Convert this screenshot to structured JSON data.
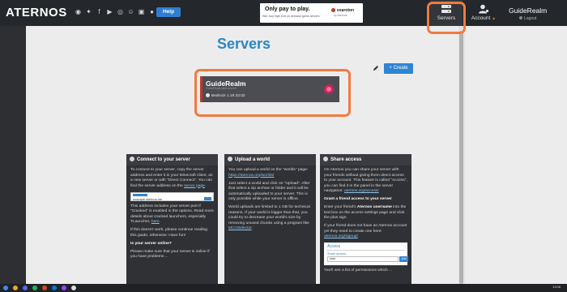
{
  "brand": {
    "logo": "ATERNOS",
    "help": "Help",
    "accent": "#2f85d2",
    "title_color": "#2c86c5"
  },
  "social_icons": [
    "steam-icon",
    "twitter-icon",
    "facebook-icon",
    "youtube-icon",
    "instagram-icon",
    "discord-icon",
    "twitch-icon",
    "github-icon"
  ],
  "ad": {
    "title": "Only pay to play.",
    "subtitle": "Win, buy high end on demand game servers",
    "brand": "exaroton",
    "brand_sub": "by Aternos"
  },
  "nav": {
    "servers_label": "Servers",
    "account_label": "Account",
    "account_warning": "▲",
    "user_name": "GuideRealm",
    "logout": "Logout"
  },
  "page": {
    "title": "Servers",
    "create_label": "+ Create"
  },
  "server": {
    "name": "GuideRealm",
    "address": "GuideRealm.aternos.me",
    "version": "Bedrock 1.19.33.02",
    "status_color": "#c9245e",
    "accent": "#c0392b"
  },
  "connect": {
    "title": "Connect to your server",
    "p1_a": "To connect to your server, copy the server address and enter it in your Minecraft client, as a new server or with \"Direct Connect\". You can find the server address on the ",
    "p1_link": "server page",
    "p1_b": ".",
    "address_example": "example.aternos.me",
    "p2_a": "This address includes your server port if \"Cracked\" is enabled in the options. Read more details about cracked launchers, especially TLauncher, ",
    "p2_link": "here",
    "p2_b": ".",
    "p3": "If this doesn't work, please continue reading this guide, otherwise: Have fun!",
    "q": "Is your server online?",
    "p4": "Please make sure that your server is online if you have problems ..."
  },
  "upload": {
    "title": "Upload a world",
    "p1_a": "You can upload a world on the \"worlds\" page: ",
    "p1_link": "https://aternos.org/worlds/",
    "p2": "Just select a world and click on \"Upload\". After that select a zip archive or folder and it will be automatically uploaded to your server. This is only possible while your server is offline.",
    "p3_a": "World uploads are limited to 1 GB for technical reasons. If your world is bigger than that, you could try to decrease your world's size by removing unused chunks using a program like ",
    "p3_link": "MCASelector",
    "p3_b": "."
  },
  "share": {
    "title": "Share access",
    "p1_a": "On Aternos you can share your server with your friends without giving them direct access to your account. This feature is called \"Access\", you can find it in the panel in the server navigation: ",
    "p1_link": "aternos.org/access/",
    "h2": "Grant a friend access to your server",
    "p2_a": "Enter your friend's ",
    "p2_b": "Aternos username",
    "p2_c": " into the text box on the access settings page and click the plus sign.",
    "p3_a": "If your friend does not have an Aternos account yet they need to create one here: ",
    "p3_link": "aternos.org/signup/",
    "box_title": "Access",
    "box_label": "Share access",
    "box_input": "user",
    "box_add": "Add",
    "p4": "You'll see a list of permissions which ..."
  },
  "taskbar": {
    "time": "13:08"
  }
}
